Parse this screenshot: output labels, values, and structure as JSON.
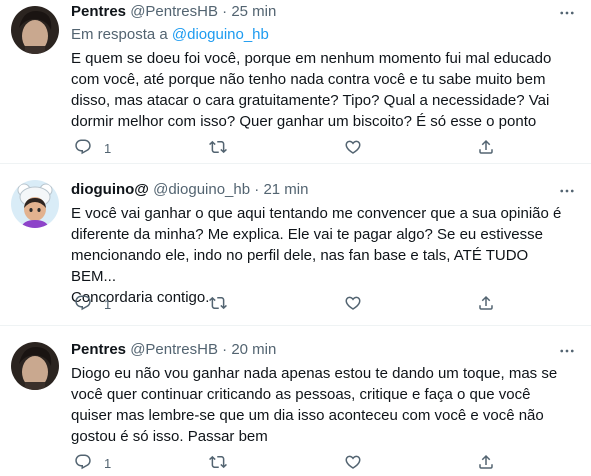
{
  "tweets": [
    {
      "name": "Pentres",
      "handle": "@PentresHB",
      "separator": "·",
      "time": "25 min",
      "reply_prefix": "Em resposta a",
      "reply_handle": "@dioguino_hb",
      "text": "E quem se doeu foi você, porque em nenhum momento fui mal educado\ncom você, até porque não tenho nada contra você e tu sabe muito bem\ndisso, mas atacar o cara gratuitamente? Tipo? Qual a necessidade? Vai\ndormir melhor com isso? Quer ganhar um biscoito? É só esse o ponto",
      "reply_count": "1",
      "retweet_count": "",
      "like_count": ""
    },
    {
      "name": "dioguino@",
      "handle": "@dioguino_hb",
      "separator": "·",
      "time": "21 min",
      "text": "E você vai ganhar o que aqui tentando me convencer que a sua opinião é\ndiferente da minha? Me explica. Ele vai te pagar algo? Se eu estivesse\nmencionando ele, indo no perfil dele, nas fan base e tals, ATÉ TUDO BEM...\nConcordaria contigo.",
      "reply_count": "1",
      "retweet_count": "",
      "like_count": ""
    },
    {
      "name": "Pentres",
      "handle": "@PentresHB",
      "separator": "·",
      "time": "20 min",
      "text": "Diogo eu não vou ganhar nada apenas estou te dando um toque, mas se\nvocê quer continuar criticando as pessoas, critique e faça o que você\nquiser mas lembre-se que um dia isso aconteceu com você e você não\ngostou é só isso. Passar bem",
      "reply_count": "1",
      "retweet_count": "",
      "like_count": ""
    }
  ],
  "colors": {
    "text": "#0f1419",
    "secondary": "#536471",
    "link": "#1d9bf0",
    "divider": "#eff3f4"
  },
  "icons": [
    "more-icon",
    "reply-icon",
    "retweet-icon",
    "like-icon",
    "share-icon"
  ]
}
